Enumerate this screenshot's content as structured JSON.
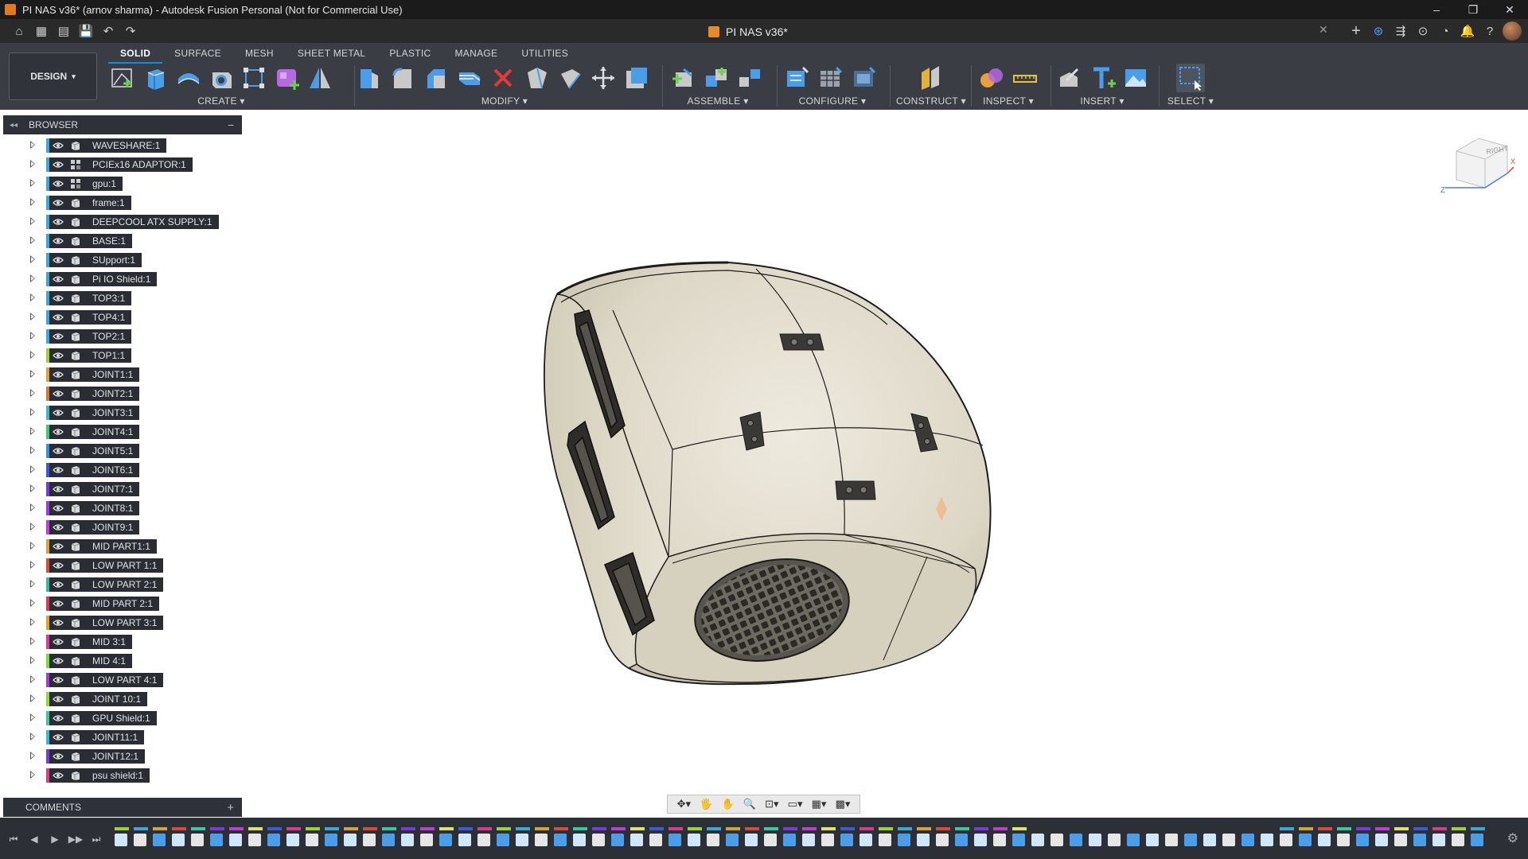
{
  "window": {
    "title": "PI NAS v36* (arnov sharma) - Autodesk Fusion Personal (Not for Commercial Use)",
    "controls": [
      "–",
      "❐",
      "✕"
    ]
  },
  "document": {
    "tab_title": "PI NAS v36*",
    "close_glyph": "✕"
  },
  "quick_access": [
    "home-icon",
    "grid-icon",
    "file-icon",
    "save-icon",
    "undo-icon",
    "redo-icon"
  ],
  "quick_access_glyphs": [
    "⌂",
    "▦",
    "▤",
    "💾",
    "↶",
    "↷"
  ],
  "top_right_icons": [
    "+",
    "⊛",
    "⇶",
    "⊙",
    "◔",
    "🔔",
    "?"
  ],
  "toolbar": {
    "workspace": "DESIGN",
    "workspace_arrow": "▾",
    "tabs": [
      "SOLID",
      "SURFACE",
      "MESH",
      "SHEET METAL",
      "PLASTIC",
      "MANAGE",
      "UTILITIES"
    ],
    "active_tab": "SOLID",
    "groups": {
      "create": "CREATE ▾",
      "modify": "MODIFY ▾",
      "assemble": "ASSEMBLE ▾",
      "configure": "CONFIGURE ▾",
      "construct": "CONSTRUCT ▾",
      "inspect": "INSPECT ▾",
      "insert": "INSERT ▾",
      "select": "SELECT ▾"
    }
  },
  "browser": {
    "title": "BROWSER",
    "collapse_glyph": "◂◂",
    "minus_glyph": "−",
    "items": [
      {
        "label": "WAVESHARE:1",
        "color": "#3aa7d8",
        "icon": "body"
      },
      {
        "label": "PCIEx16 ADAPTOR:1",
        "color": "#3aa7d8",
        "icon": "component"
      },
      {
        "label": "gpu:1",
        "color": "#3aa7d8",
        "icon": "component"
      },
      {
        "label": "frame:1",
        "color": "#3aa7d8",
        "icon": "body"
      },
      {
        "label": "DEEPCOOL ATX SUPPLY:1",
        "color": "#3aa7d8",
        "icon": "body"
      },
      {
        "label": "BASE:1",
        "color": "#3aa7d8",
        "icon": "body"
      },
      {
        "label": "SUpport:1",
        "color": "#3aa7d8",
        "icon": "body"
      },
      {
        "label": "Pi IO Shield:1",
        "color": "#3aa7d8",
        "icon": "body"
      },
      {
        "label": "TOP3:1",
        "color": "#3aa7d8",
        "icon": "body"
      },
      {
        "label": "TOP4:1",
        "color": "#3aa7d8",
        "icon": "body"
      },
      {
        "label": "TOP2:1",
        "color": "#3aa7d8",
        "icon": "body"
      },
      {
        "label": "TOP1:1",
        "color": "#9bd43a",
        "icon": "body"
      },
      {
        "label": "JOINT1:1",
        "color": "#d8a13a",
        "icon": "body"
      },
      {
        "label": "JOINT2:1",
        "color": "#d8763a",
        "icon": "body"
      },
      {
        "label": "JOINT3:1",
        "color": "#3ab8c8",
        "icon": "body"
      },
      {
        "label": "JOINT4:1",
        "color": "#3ac87a",
        "icon": "body"
      },
      {
        "label": "JOINT5:1",
        "color": "#3a8fd8",
        "icon": "body"
      },
      {
        "label": "JOINT6:1",
        "color": "#3a5ad8",
        "icon": "body"
      },
      {
        "label": "JOINT7:1",
        "color": "#7a3ad8",
        "icon": "body"
      },
      {
        "label": "JOINT8:1",
        "color": "#a33ad8",
        "icon": "body"
      },
      {
        "label": "JOINT9:1",
        "color": "#c03ad8",
        "icon": "body"
      },
      {
        "label": "MID PART1:1",
        "color": "#d8a13a",
        "icon": "body"
      },
      {
        "label": "LOW PART 1:1",
        "color": "#d84a3a",
        "icon": "body"
      },
      {
        "label": "LOW PART 2:1",
        "color": "#3ab8a3",
        "icon": "body"
      },
      {
        "label": "MID PART 2:1",
        "color": "#d83a5a",
        "icon": "body"
      },
      {
        "label": "LOW PART 3:1",
        "color": "#d8a13a",
        "icon": "body"
      },
      {
        "label": "MID 3:1",
        "color": "#d83a9b",
        "icon": "body"
      },
      {
        "label": "MID 4:1",
        "color": "#7ad83a",
        "icon": "body"
      },
      {
        "label": "LOW PART 4:1",
        "color": "#a33ad8",
        "icon": "body"
      },
      {
        "label": "JOINT 10:1",
        "color": "#9bd43a",
        "icon": "body"
      },
      {
        "label": "GPU Shield:1",
        "color": "#3ac8a3",
        "icon": "body"
      },
      {
        "label": "JOINT11:1",
        "color": "#3ab8d8",
        "icon": "body"
      },
      {
        "label": "JOINT12:1",
        "color": "#7a3ad8",
        "icon": "body"
      },
      {
        "label": "psu shield:1",
        "color": "#d83a8f",
        "icon": "body"
      }
    ]
  },
  "comments": {
    "title": "COMMENTS",
    "plus_glyph": "+"
  },
  "viewcube": {
    "face": "RIGHT",
    "axis_z": "Z",
    "axis_x": "X"
  },
  "navbar": [
    "✥▾",
    "🖐",
    "✋",
    "🔍",
    "⊡▾",
    "▭▾",
    "▦▾",
    "▩▾"
  ],
  "timeline": {
    "controls": [
      "⏮",
      "◀",
      "▶",
      "▶▶",
      "⏭"
    ],
    "gear_glyph": "⚙"
  }
}
